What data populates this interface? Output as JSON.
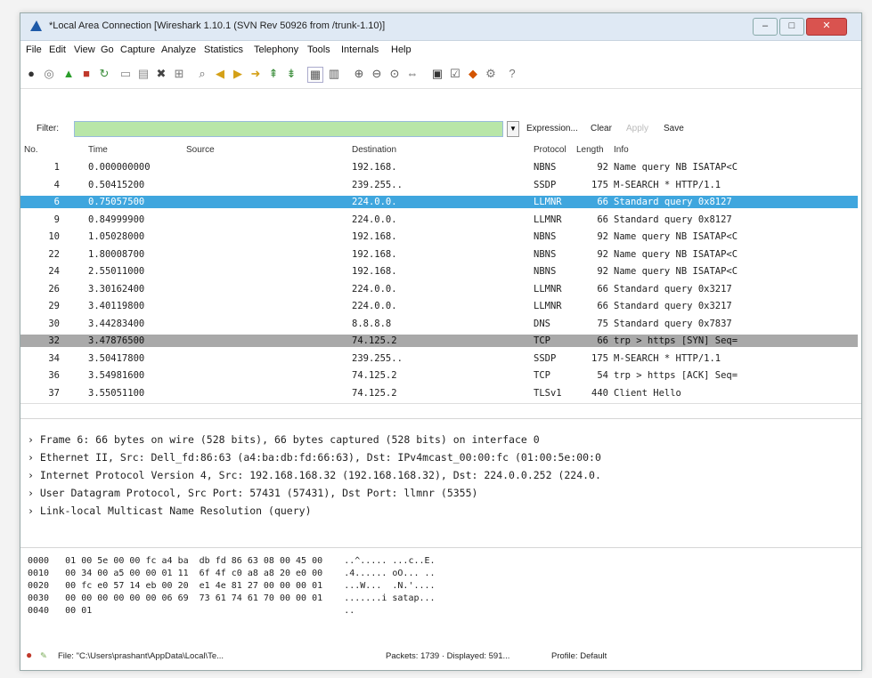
{
  "window": {
    "title": "*Local Area Connection  [Wireshark 1.10.1  (SVN Rev 50926 from /trunk-1.10)]",
    "controls": [
      "–",
      "□",
      "✕"
    ]
  },
  "menu": [
    "File",
    "Edit",
    "View",
    "Go",
    "Capture",
    "Analyze",
    "Statistics",
    "Telephony",
    "Tools",
    "Internals",
    "Help"
  ],
  "toolbar": {
    "icons": [
      "interfaces-icon",
      "options-icon",
      "start-capture-icon",
      "stop-capture-icon",
      "restart-icon",
      "open-icon",
      "save-icon",
      "close-icon",
      "reload-icon",
      "find-icon",
      "back-icon",
      "forward-icon",
      "goto-icon",
      "top-icon",
      "bottom-icon",
      "colorize-icon",
      "autoscroll-icon",
      "zoom-in-icon",
      "zoom-out-icon",
      "zoom-normal-icon",
      "resize-columns-icon",
      "capture-filters-icon",
      "display-filters-icon",
      "coloring-rules-icon",
      "preferences-icon",
      "help-icon"
    ]
  },
  "filter": {
    "label": "Filter:",
    "value": "",
    "links": [
      "Expression...",
      "Clear",
      "Apply",
      "Save"
    ]
  },
  "packet_list": {
    "columns": [
      "No.",
      "Time",
      "Source",
      "Destination",
      "Protocol",
      "Length",
      "Info"
    ],
    "rows": [
      {
        "no": "1",
        "time": "0.000000000",
        "dst": "192.168.",
        "proto": "NBNS",
        "len": "92",
        "info": "Name query NB ISATAP<C",
        "style": ""
      },
      {
        "no": "4",
        "time": "0.50415200",
        "dst": "239.255..",
        "proto": "SSDP",
        "len": "175",
        "info": "M-SEARCH * HTTP/1.1",
        "style": ""
      },
      {
        "no": "6",
        "time": "0.75057500",
        "dst": "224.0.0.",
        "proto": "LLMNR",
        "len": "66",
        "info": "Standard query 0x8127",
        "style": "sel"
      },
      {
        "no": "9",
        "time": "0.84999900",
        "dst": "224.0.0.",
        "proto": "LLMNR",
        "len": "66",
        "info": "Standard query 0x8127",
        "style": ""
      },
      {
        "no": "10",
        "time": "1.05028000",
        "dst": "192.168.",
        "proto": "NBNS",
        "len": "92",
        "info": "Name query NB ISATAP<C",
        "style": ""
      },
      {
        "no": "22",
        "time": "1.80008700",
        "dst": "192.168.",
        "proto": "NBNS",
        "len": "92",
        "info": "Name query NB ISATAP<C",
        "style": ""
      },
      {
        "no": "24",
        "time": "2.55011000",
        "dst": "192.168.",
        "proto": "NBNS",
        "len": "92",
        "info": "Name query NB ISATAP<C",
        "style": ""
      },
      {
        "no": "26",
        "time": "3.30162400",
        "dst": "224.0.0.",
        "proto": "LLMNR",
        "len": "66",
        "info": "Standard query 0x3217",
        "style": ""
      },
      {
        "no": "29",
        "time": "3.40119800",
        "dst": "224.0.0.",
        "proto": "LLMNR",
        "len": "66",
        "info": "Standard query 0x3217",
        "style": ""
      },
      {
        "no": "30",
        "time": "3.44283400",
        "dst": "8.8.8.8",
        "proto": "DNS",
        "len": "75",
        "info": "Standard query 0x7837",
        "style": ""
      },
      {
        "no": "32",
        "time": "3.47876500",
        "dst": "74.125.2",
        "proto": "TCP",
        "len": "66",
        "info": "trp > https [SYN] Seq=",
        "style": "hl"
      },
      {
        "no": "34",
        "time": "3.50417800",
        "dst": "239.255..",
        "proto": "SSDP",
        "len": "175",
        "info": "M-SEARCH * HTTP/1.1",
        "style": ""
      },
      {
        "no": "36",
        "time": "3.54981600",
        "dst": "74.125.2",
        "proto": "TCP",
        "len": "54",
        "info": "trp > https [ACK] Seq=",
        "style": ""
      },
      {
        "no": "37",
        "time": "3.55051100",
        "dst": "74.125.2",
        "proto": "TLSv1",
        "len": "440",
        "info": "Client Hello",
        "style": ""
      }
    ]
  },
  "details": [
    "Frame 6: 66 bytes on wire (528 bits), 66 bytes captured (528 bits) on interface 0",
    "Ethernet II, Src: Dell_fd:86:63 (a4:ba:db:fd:66:63), Dst: IPv4mcast_00:00:fc (01:00:5e:00:0",
    "Internet Protocol Version 4, Src: 192.168.168.32 (192.168.168.32), Dst: 224.0.0.252 (224.0.",
    "User Datagram Protocol, Src Port: 57431 (57431), Dst Port: llmnr (5355)",
    "Link-local Multicast Name Resolution (query)"
  ],
  "bytes": [
    "0000   01 00 5e 00 00 fc a4 ba  db fd 86 63 08 00 45 00    ..^..... ...c..E.",
    "0010   00 34 00 a5 00 00 01 11  6f 4f c0 a8 a8 20 e0 00    .4...... oO... ..",
    "0020   00 fc e0 57 14 eb 00 20  e1 4e 81 27 00 00 00 01    ...W...  .N.'....",
    "0030   00 00 00 00 00 00 06 69  73 61 74 61 70 00 00 01    .......i satap...",
    "0040   00 01                                               .."
  ],
  "status": {
    "file": "File: \"C:\\Users\\prashant\\AppData\\Local\\Te...",
    "packets": "Packets: 1739 · Displayed: 591...",
    "profile": "Profile: Default"
  },
  "colors": {
    "selected_row": "#3fa6de",
    "highlight_row": "#a9a9a9",
    "filter_bg": "#b8e6a8"
  }
}
